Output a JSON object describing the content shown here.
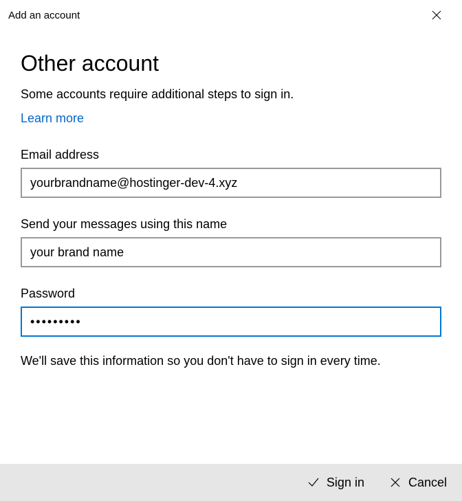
{
  "titlebar": {
    "title": "Add an account"
  },
  "heading": "Other account",
  "subtext": "Some accounts require additional steps to sign in.",
  "learn_more": "Learn more",
  "fields": {
    "email": {
      "label": "Email address",
      "value": "yourbrandname@hostinger-dev-4.xyz"
    },
    "name": {
      "label": "Send your messages using this name",
      "value": "your brand name"
    },
    "password": {
      "label": "Password",
      "value": "•••••••••"
    }
  },
  "save_note": "We'll save this information so you don't have to sign in every time.",
  "footer": {
    "signin": "Sign in",
    "cancel": "Cancel"
  }
}
